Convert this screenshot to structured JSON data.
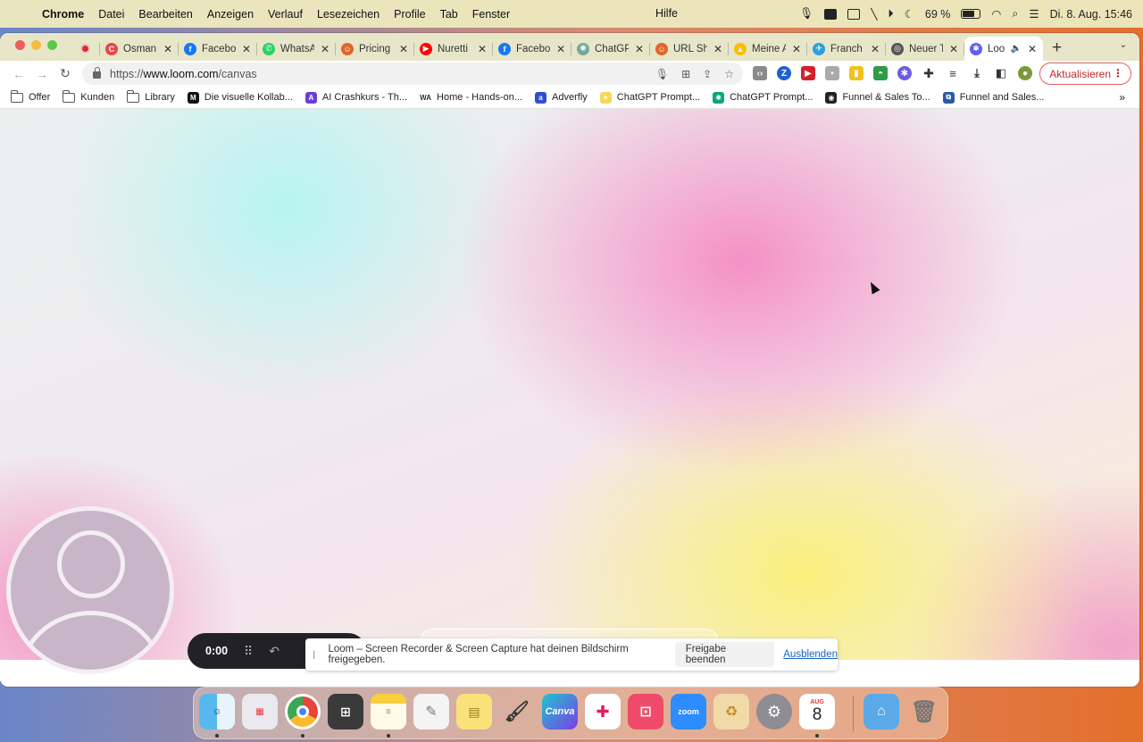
{
  "menubar": {
    "app": "Chrome",
    "items": [
      "Datei",
      "Bearbeiten",
      "Anzeigen",
      "Verlauf",
      "Lesezeichen",
      "Profile",
      "Tab",
      "Fenster"
    ],
    "help": "Hilfe",
    "battery_percent": "69 %",
    "datetime": "Di. 8. Aug.  15:46"
  },
  "tabs": [
    {
      "label": "Osman",
      "color": "#e54848",
      "glyph": "C"
    },
    {
      "label": "Facebo",
      "color": "#1877f2",
      "glyph": "f"
    },
    {
      "label": "WhatsA",
      "color": "#25d366",
      "glyph": "✆"
    },
    {
      "label": "Pricing",
      "color": "#e0652a",
      "glyph": "☺"
    },
    {
      "label": "Nuretti",
      "color": "#ff0000",
      "glyph": "▶"
    },
    {
      "label": "Facebo",
      "color": "#1877f2",
      "glyph": "f"
    },
    {
      "label": "ChatGP",
      "color": "#74aa9c",
      "glyph": "✺"
    },
    {
      "label": "URL Sh",
      "color": "#e0652a",
      "glyph": "☺"
    },
    {
      "label": "Meine A",
      "color": "#fbbc04",
      "glyph": "▲"
    },
    {
      "label": "Franch",
      "color": "#2aa1da",
      "glyph": "✈"
    },
    {
      "label": "Neuer T",
      "color": "#555555",
      "glyph": "◎"
    }
  ],
  "active_tab": {
    "label": "Loo",
    "color": "#625df5",
    "glyph": "✱"
  },
  "address_bar": {
    "scheme": "https://",
    "host": "www.loom.com",
    "path": "/canvas"
  },
  "update_button": "Aktualisieren",
  "bookmarks": [
    {
      "label": "Offer",
      "type": "folder"
    },
    {
      "label": "Kunden",
      "type": "folder"
    },
    {
      "label": "Library",
      "type": "folder"
    },
    {
      "label": "Die visuelle Kollab...",
      "type": "site",
      "color": "#111111",
      "glyph": "M"
    },
    {
      "label": "AI Crashkurs - Th...",
      "type": "site",
      "color": "#6b3fd6",
      "glyph": "A"
    },
    {
      "label": "Home - Hands-on...",
      "type": "site",
      "color": "#ffffff",
      "glyph": "WA"
    },
    {
      "label": "Adverfly",
      "type": "site",
      "color": "#3050c8",
      "glyph": "a"
    },
    {
      "label": "ChatGPT Prompt...",
      "type": "site",
      "color": "#f2d95c",
      "glyph": "✦"
    },
    {
      "label": "ChatGPT Prompt...",
      "type": "site",
      "color": "#10a37f",
      "glyph": "✺"
    },
    {
      "label": "Funnel & Sales To...",
      "type": "site",
      "color": "#222222",
      "glyph": "◉"
    },
    {
      "label": "Funnel and Sales...",
      "type": "site",
      "color": "#2b5aa0",
      "glyph": "⧉"
    }
  ],
  "recording": {
    "timer": "0:00"
  },
  "share_banner": {
    "message": "Loom – Screen Recorder & Screen Capture hat deinen Bildschirm freigegeben.",
    "stop_label": "Freigabe beenden",
    "hide_label": "Ausblenden"
  },
  "dock": {
    "calendar_month": "AUG",
    "calendar_day": "8",
    "canva_label": "Canva",
    "zoom_label": "zoom"
  },
  "colors": {
    "accent_update": "#c0292b",
    "loom_purple": "#625df5",
    "link_blue": "#1a63c6"
  }
}
